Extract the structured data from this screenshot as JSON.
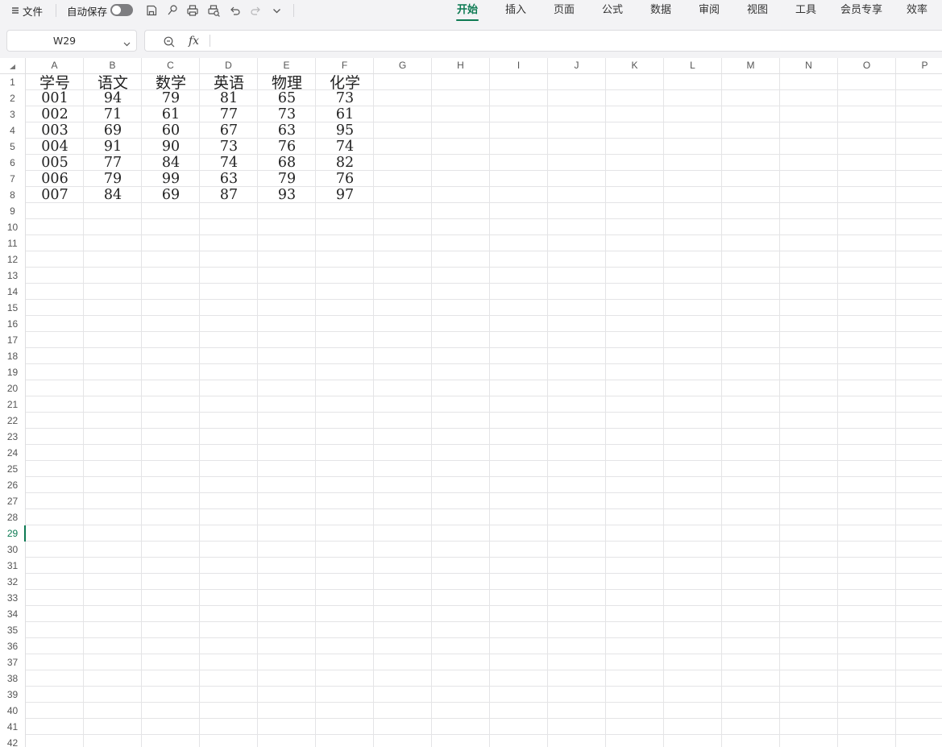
{
  "toolbar": {
    "menu_label": "文件",
    "autosave_label": "自动保存",
    "autosave_on": false,
    "tabs": [
      "开始",
      "插入",
      "页面",
      "公式",
      "数据",
      "审阅",
      "视图",
      "工具",
      "会员专享",
      "效率"
    ],
    "active_tab": "开始"
  },
  "formula_bar": {
    "cell_reference": "W29",
    "formula_value": ""
  },
  "sheet": {
    "columns": [
      "A",
      "B",
      "C",
      "D",
      "E",
      "F",
      "G",
      "H",
      "I",
      "J",
      "K",
      "L",
      "M",
      "N",
      "O",
      "P"
    ],
    "visible_row_count": 42,
    "active_row": 29,
    "headers": [
      "学号",
      "语文",
      "数学",
      "英语",
      "物理",
      "化学"
    ],
    "rows": [
      [
        "001",
        "94",
        "79",
        "81",
        "65",
        "73"
      ],
      [
        "002",
        "71",
        "61",
        "77",
        "73",
        "61"
      ],
      [
        "003",
        "69",
        "60",
        "67",
        "63",
        "95"
      ],
      [
        "004",
        "91",
        "90",
        "73",
        "76",
        "74"
      ],
      [
        "005",
        "77",
        "84",
        "74",
        "68",
        "82"
      ],
      [
        "006",
        "79",
        "99",
        "63",
        "79",
        "76"
      ],
      [
        "007",
        "84",
        "69",
        "87",
        "93",
        "97"
      ]
    ]
  },
  "colors": {
    "accent": "#0d7a53",
    "gridline": "#e4e4e6",
    "toolbar_bg": "#f3f3f5"
  }
}
